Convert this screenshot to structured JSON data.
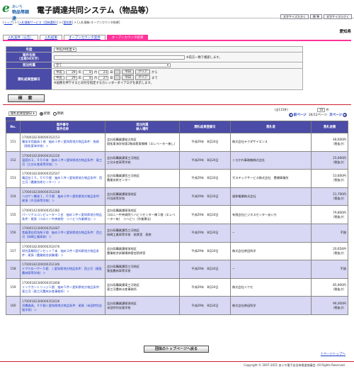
{
  "header": {
    "logo_line1": "あいち",
    "logo_line2": "物品等調達",
    "title": "電子調達共同システム（物品等）",
    "btn_font": "文字サイズ大きく",
    "btn_std": "標 準",
    "btn_font_small": "文字サイズ小さく"
  },
  "breadcrumb": {
    "top": "トップ",
    "sep1": " > ",
    "service": "入札情報サービス（団体選択）",
    "sep2": " > ",
    "pref": "愛知県",
    "sep3": " > ",
    "current": "入札情報-オープンカウンタ結果"
  },
  "prefecture": "愛知県",
  "tabs": [
    {
      "label": "入札案件（公告）"
    },
    {
      "label": "入札結果"
    },
    {
      "label": "オープンカウンタ案件"
    },
    {
      "label": "オープンカウンタ結果"
    }
  ],
  "form": {
    "fiscal_label": "年度",
    "fiscal_value": "平成29年度",
    "case_label": "案件名称\n（全角50文字）",
    "case_note": "※前方一致で検索します。",
    "org_label": "発注所属",
    "org_value": "全て",
    "date_label": "開札結果登録日",
    "era1": "平成",
    "y1": "29",
    "m1": "8",
    "d1": "23",
    "era2": "平成",
    "y2": "29",
    "m2": "8",
    "d2": "27",
    "year_unit": "年",
    "month_unit": "月",
    "day_unit": "日",
    "today": "今日",
    "clear": "クリア",
    "from": "から",
    "to": "まで",
    "cal_note": "※画像を押下すると日付を指定するカレンダーダイアログを表示します。"
  },
  "search_btn": "検 索",
  "sort": {
    "select": "開札結果登録日",
    "asc": "昇順",
    "desc": "降順"
  },
  "count_text": "(全115件)",
  "pager": {
    "per_page": "10",
    "per_unit": "件",
    "next": "次ページ",
    "prev": "前ページ",
    "page_info": "16/12ページ"
  },
  "table": {
    "headers": [
      "No.",
      "案件番号\n案件名称",
      "発注所属\n納入場所",
      "開札結果登録日",
      "落札者",
      "落札金額"
    ],
    "rows": [
      {
        "no": "151",
        "id": "17000182300000352153",
        "subj": "電化学用器具１他　抽め１件＜愛知県地方物品条件：指接（翔拓東海学校）＞",
        "org": "会計局購買課発注地区\n翔拓東海学校東2階本館東郷棟（エレベーター無し）",
        "date": "平成29年　8月24日",
        "win": "株式会社テクダサイエンス",
        "amt": "48,600円",
        "tax": "（税抜き）"
      },
      {
        "no": "152",
        "id": "17000182300000352226",
        "subj": "温度計２，０００本　抽め１件＜愛知県地方物品条件：東三河（三谷水産高等学校）＞",
        "org": "会計局購買課東三河地区\n三谷水産高等学校",
        "date": "平成29年　8月24日",
        "win": "くろかわ事務機株式会社",
        "amt": "25,600円",
        "tax": "（税抜き）"
      },
      {
        "no": "153",
        "id": "17000182300000352507",
        "subj": "電話台１０，０００個　抽め１件＜愛知県地方物品条件：西三河（農業技術センター）＞",
        "org": "会計局購買課西三河地区\n農業技術センター",
        "date": "平成29年　8月24日",
        "win": "ガステックサービス株式会社　豊橋事業所",
        "amt": "53,600円",
        "tax": "（税抜き）"
      },
      {
        "no": "154",
        "id": "17000182300000352208",
        "subj": "ハロゲン電球１，００個　抽め２件＜愛知県地方物品条件：尾張（丹羽高等学校）＞",
        "org": "会計局購買課尾張地区\n丹羽高等学校",
        "date": "平成29年　8月24日",
        "win": "福和電業株式会社",
        "amt": "21,700円",
        "tax": "（税抜き）"
      },
      {
        "no": "155",
        "id": "17000142300000352382",
        "subj": "パーソナルコンピューター１台　抽め１件＜愛知県地方物品条件：尾張（コロニー中央病院　リハビリ作業療法）＞",
        "org": "会計局購買課尾張地区\nコロニー中央病院リハビリセンター棟１階（エレベーター有）　リハビリ（作業療法）",
        "date": "平成29年　8月24日",
        "win": "有限会社ビジネスセンターあいち",
        "amt": "79,800円",
        "tax": "（税抜き）"
      },
      {
        "no": "156",
        "id": "17000152300000352487",
        "subj": "食器漂白用洗剤２個　抽め２件＜愛知県地方物品条件：西三河（岡崎工業高校）＞",
        "org": "会計局購買課西三河地区\n岡崎工業高等学校　給食室　厨房",
        "date": "平成29年　8月24日",
        "win": "−",
        "amt": "不調",
        "tax": ""
      },
      {
        "no": "157",
        "id": "17000182300000352476",
        "subj": "研究実験用ピンセット７本　抽め２件＜愛知県地方物品条件：尾張（農業総合試験場）＞",
        "org": "会計局購買課尾張地区\n農業総合試験場病害虫防除室",
        "date": "平成29年　8月24日",
        "win": "株式会社柴田科学",
        "amt": "20,654円",
        "tax": "（税抜き）"
      },
      {
        "no": "158",
        "id": "17000182300000352346",
        "subj": "ドアクローザー５個　く愛知県地方物品条件：西三河（猿投農林高等学校）＞",
        "org": "会計局購買課西三河地区\n猿投農林高等学校",
        "date": "平成29年　8月24日",
        "win": "−",
        "amt": "不調",
        "tax": ""
      },
      {
        "no": "159",
        "id": "17000182300000351808",
        "subj": "インクカートリッジ１個　抽め５件＜愛知県地方物品条件：東三河（東三河農林水産事務所）＞",
        "org": "会計局購買課東三河地区\n東三河農林水産事務所",
        "date": "平成29年　8月24日",
        "win": "株式会社イクセ",
        "amt": "85,900円",
        "tax": "（税抜き）"
      },
      {
        "no": "160",
        "id": "17000182300000352026",
        "subj": "消費器具，００個＜愛知県地方物品条件：尾張（半田特別支援学校）＞",
        "org": "会計局購買課尾張地区\n半田特別支援学校",
        "date": "平成29年　8月24日",
        "win": "株式会社柴田科学",
        "amt": "96,000円",
        "tax": "（税抜き）"
      }
    ]
  },
  "back_btn": "団体のトップページへ戻る",
  "top_link": "↑ページトップへ",
  "footer": "Copyright © 2007-2021 あいち電子自治体推進協議会. All Rights Reserved."
}
